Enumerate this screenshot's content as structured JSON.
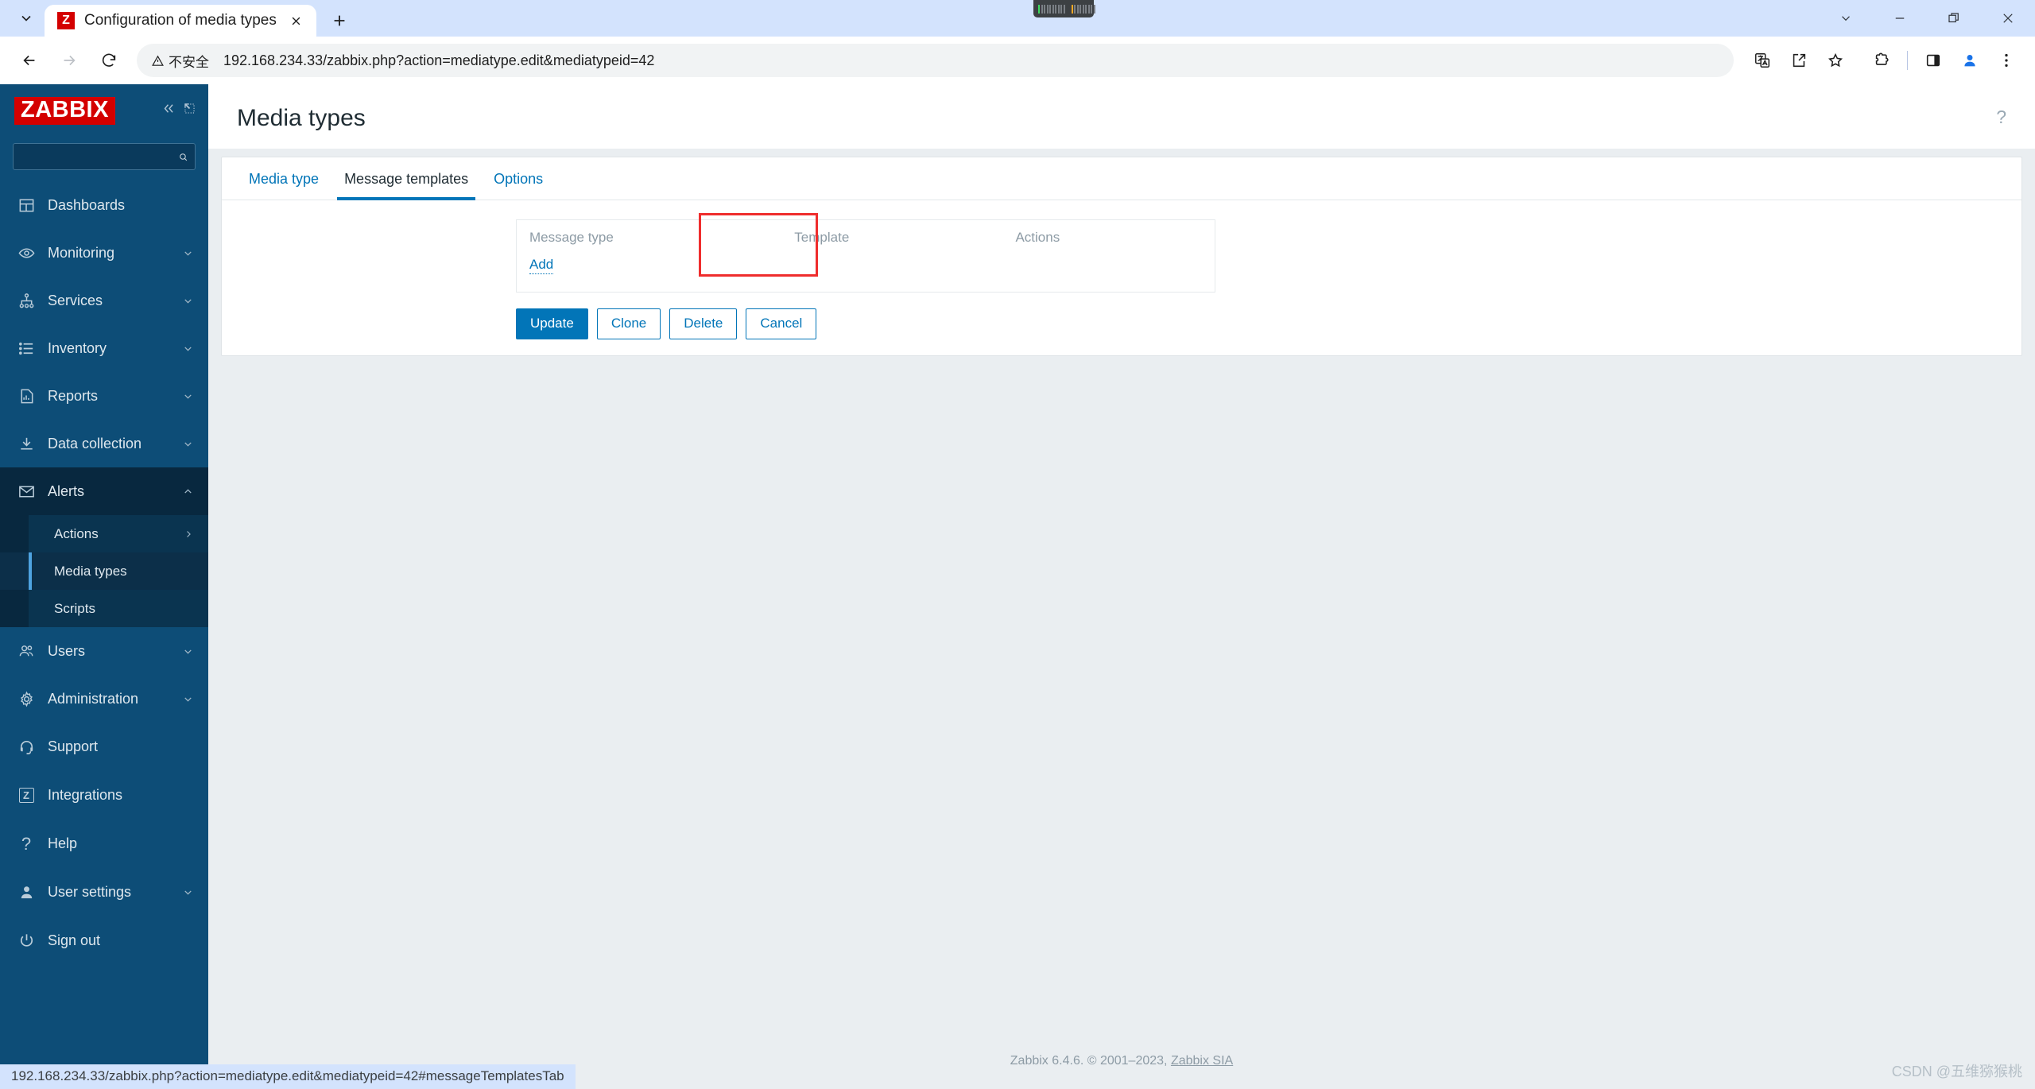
{
  "browser": {
    "tab": {
      "title": "Configuration of media types",
      "favicon_letter": "Z"
    },
    "new_tab_label": "+",
    "omnibox": {
      "security_label": "不安全",
      "url": "192.168.234.33/zabbix.php?action=mediatype.edit&mediatypeid=42"
    },
    "status_bar_url": "192.168.234.33/zabbix.php?action=mediatype.edit&mediatypeid=42#messageTemplatesTab"
  },
  "sidebar": {
    "logo": "ZABBIX",
    "search_placeholder": "",
    "search_value": "",
    "items": [
      {
        "label": "Dashboards",
        "icon": "dashboard-icon",
        "arrow": ""
      },
      {
        "label": "Monitoring",
        "icon": "eye-icon",
        "arrow": "down"
      },
      {
        "label": "Services",
        "icon": "services-icon",
        "arrow": "down"
      },
      {
        "label": "Inventory",
        "icon": "list-icon",
        "arrow": "down"
      },
      {
        "label": "Reports",
        "icon": "report-icon",
        "arrow": "down"
      },
      {
        "label": "Data collection",
        "icon": "download-icon",
        "arrow": "down"
      },
      {
        "label": "Alerts",
        "icon": "envelope-icon",
        "arrow": "up"
      }
    ],
    "alerts_submenu": [
      {
        "label": "Actions",
        "arrow": "right",
        "selected": false
      },
      {
        "label": "Media types",
        "arrow": "",
        "selected": true
      },
      {
        "label": "Scripts",
        "arrow": "",
        "selected": false
      }
    ],
    "items_after": [
      {
        "label": "Users",
        "icon": "users-icon",
        "arrow": "down"
      },
      {
        "label": "Administration",
        "icon": "gear-icon",
        "arrow": "down"
      }
    ],
    "bottom_items": [
      {
        "label": "Support",
        "icon": "headset-icon",
        "arrow": ""
      },
      {
        "label": "Integrations",
        "icon": "zabbix-badge-icon",
        "arrow": ""
      },
      {
        "label": "Help",
        "icon": "question-icon",
        "arrow": ""
      },
      {
        "label": "User settings",
        "icon": "person-icon",
        "arrow": "down"
      },
      {
        "label": "Sign out",
        "icon": "power-icon",
        "arrow": ""
      }
    ]
  },
  "main": {
    "page_title": "Media types",
    "help_icon_label": "?",
    "tabs": [
      {
        "label": "Media type",
        "active": false
      },
      {
        "label": "Message templates",
        "active": true
      },
      {
        "label": "Options",
        "active": false
      }
    ],
    "message_templates": {
      "columns": [
        "Message type",
        "Template",
        "Actions"
      ],
      "rows": [],
      "add_label": "Add"
    },
    "buttons": [
      {
        "label": "Update",
        "style": "primary"
      },
      {
        "label": "Clone",
        "style": "secondary"
      },
      {
        "label": "Delete",
        "style": "secondary"
      },
      {
        "label": "Cancel",
        "style": "secondary"
      }
    ],
    "footer": {
      "text": "Zabbix 6.4.6. © 2001–2023, ",
      "link": "Zabbix SIA"
    }
  },
  "watermark": "CSDN @五维猕猴桃",
  "colors": {
    "zabbix_red": "#d40000",
    "sidebar_blue": "#0d4d77",
    "accent_blue": "#0275b8",
    "highlight_red": "#ef2d2d"
  }
}
